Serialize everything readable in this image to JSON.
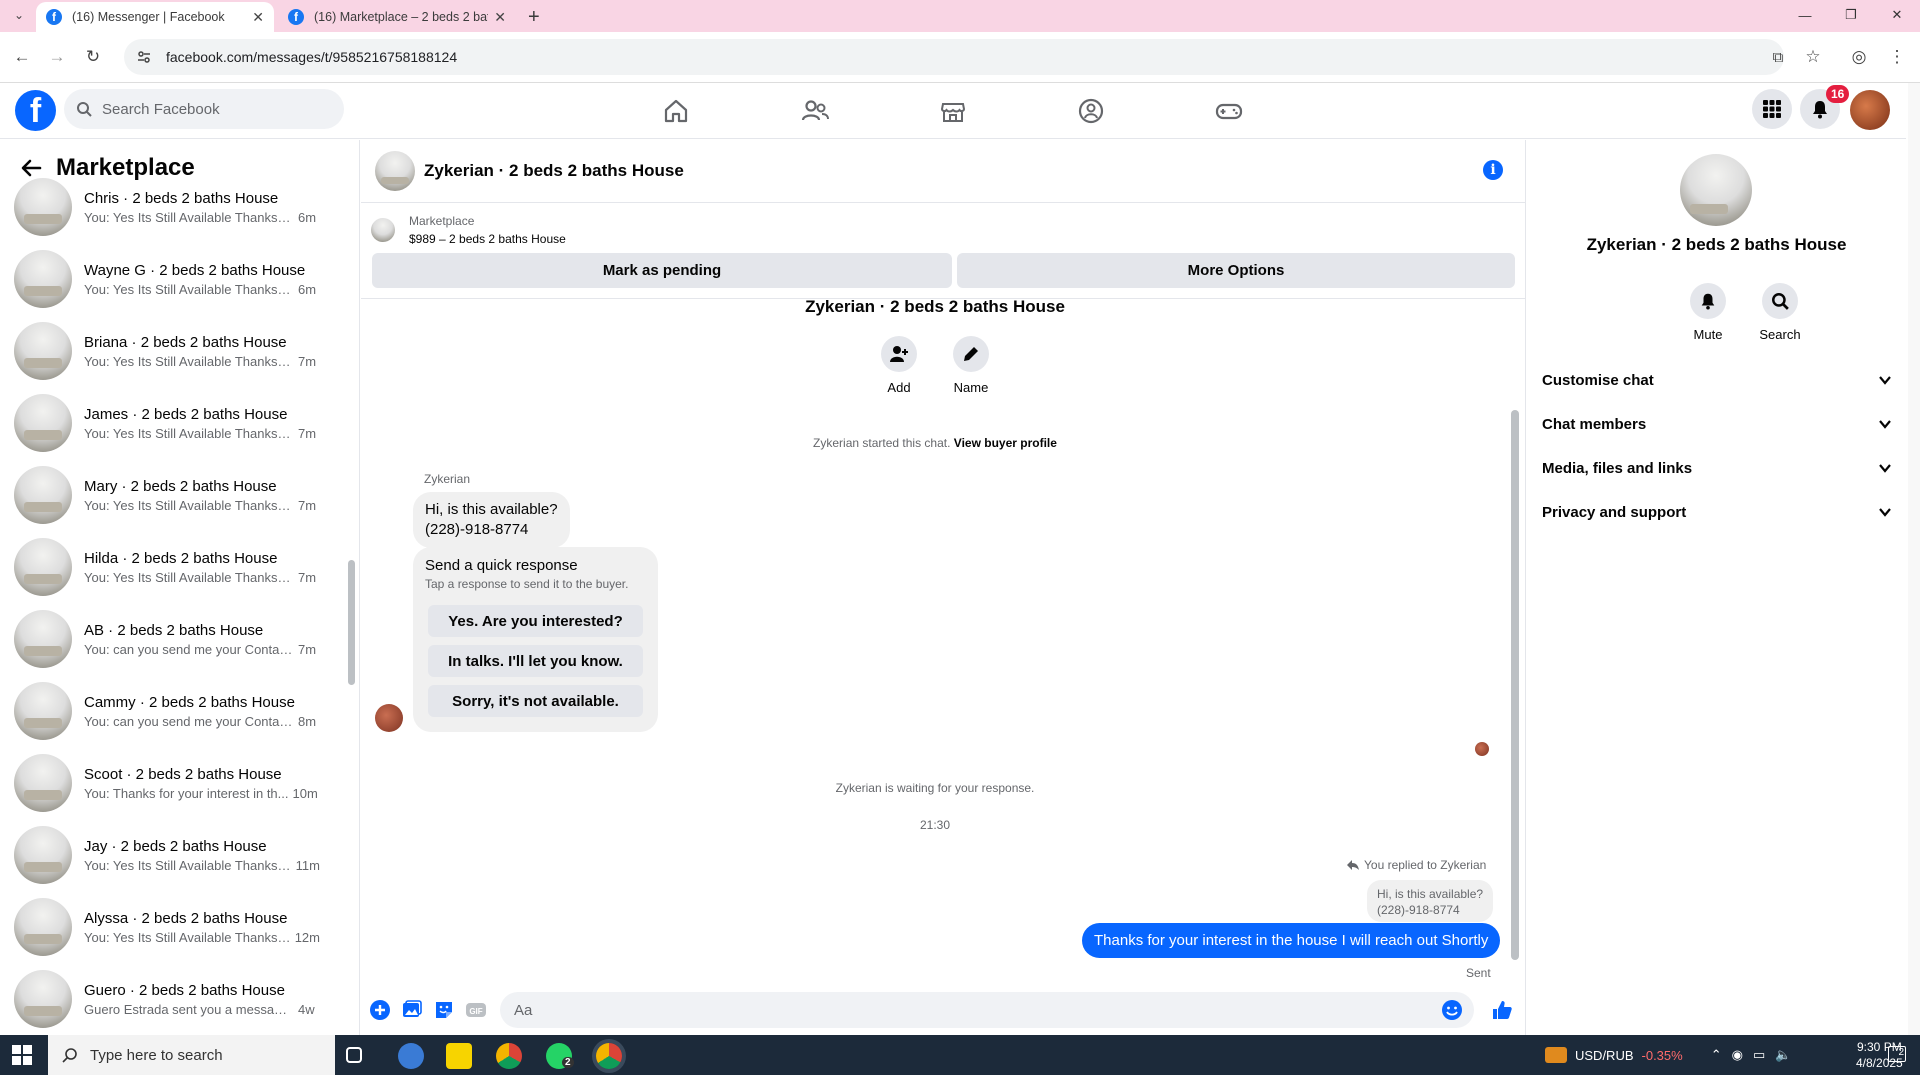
{
  "browser": {
    "tabs": [
      {
        "title": "(16) Messenger | Facebook",
        "active": true
      },
      {
        "title": "(16) Marketplace – 2 beds 2 bat",
        "active": false
      }
    ],
    "new_tab": "+",
    "url": "facebook.com/messages/t/9585216758188124"
  },
  "header": {
    "search_placeholder": "Search Facebook",
    "notification_count": "16",
    "brand_color": "#0866ff"
  },
  "left": {
    "title": "Marketplace",
    "chats": [
      {
        "name": "Chris · 2 beds 2 baths House",
        "snippet": "You: Yes Its Still Available Thanks fo...",
        "age": "6m"
      },
      {
        "name": "Wayne G · 2 beds 2 baths House",
        "snippet": "You: Yes Its Still Available Thanks fo...",
        "age": "6m"
      },
      {
        "name": "Briana · 2 beds 2 baths House",
        "snippet": "You: Yes Its Still Available Thanks fo...",
        "age": "7m"
      },
      {
        "name": "James · 2 beds 2 baths House",
        "snippet": "You: Yes Its Still Available Thanks fo...",
        "age": "7m"
      },
      {
        "name": "Mary · 2 beds 2 baths House",
        "snippet": "You: Yes Its Still Available Thanks fo...",
        "age": "7m"
      },
      {
        "name": "Hilda · 2 beds 2 baths House",
        "snippet": "You: Yes Its Still Available Thanks fo...",
        "age": "7m"
      },
      {
        "name": "AB · 2 beds 2 baths House",
        "snippet": "You: can you send me your Contac...",
        "age": "7m"
      },
      {
        "name": "Cammy · 2 beds 2 baths House",
        "snippet": "You: can you send me your Contac...",
        "age": "8m"
      },
      {
        "name": "Scoot · 2 beds 2 baths House",
        "snippet": "You: Thanks for your interest in th...",
        "age": "10m"
      },
      {
        "name": "Jay · 2 beds 2 baths House",
        "snippet": "You: Yes Its Still Available Thanks f...",
        "age": "11m"
      },
      {
        "name": "Alyssa · 2 beds 2 baths House",
        "snippet": "You: Yes Its Still Available Thanks f...",
        "age": "12m"
      },
      {
        "name": "Guero · 2 beds 2 baths House",
        "snippet": "Guero Estrada sent you a message ...",
        "age": "4w"
      }
    ]
  },
  "conversation": {
    "title": "Zykerian · 2 beds 2 baths House",
    "listing_source": "Marketplace",
    "listing_price": "$989 – 2 beds 2 baths House",
    "mark_pending": "Mark as pending",
    "more_options": "More Options",
    "hero_name": "Zykerian · 2 beds 2 baths House",
    "add_label": "Add",
    "name_label": "Name",
    "started_text": "Zykerian started this chat.",
    "view_profile": "View buyer profile",
    "sender": "Zykerian",
    "incoming_line1": "Hi, is this available?",
    "incoming_line2": "(228)-918-8774",
    "quick_title": "Send a quick response",
    "quick_sub": "Tap a response to send it to the buyer.",
    "quick_responses": [
      "Yes. Are you interested?",
      "In talks. I'll let you know.",
      "Sorry, it's not available."
    ],
    "waiting_text": "Zykerian is waiting for your response.",
    "time": "21:30",
    "replied_to": "You replied to Zykerian",
    "quoted_line1": "Hi, is this available?",
    "quoted_line2": "(228)-918-8774",
    "outgoing": "Thanks for your interest in the house I will reach out Shortly",
    "sent": "Sent",
    "input_placeholder": "Aa"
  },
  "right": {
    "name": "Zykerian · 2 beds 2 baths House",
    "mute": "Mute",
    "search": "Search",
    "sections": [
      "Customise chat",
      "Chat members",
      "Media, files and links",
      "Privacy and support"
    ]
  },
  "taskbar": {
    "search_placeholder": "Type here to search",
    "currency_pair": "USD/RUB",
    "currency_change": "-0.35%",
    "time": "9:30 PM",
    "date": "4/8/2025",
    "whatsapp_badge": "2",
    "notify_count": "2"
  }
}
